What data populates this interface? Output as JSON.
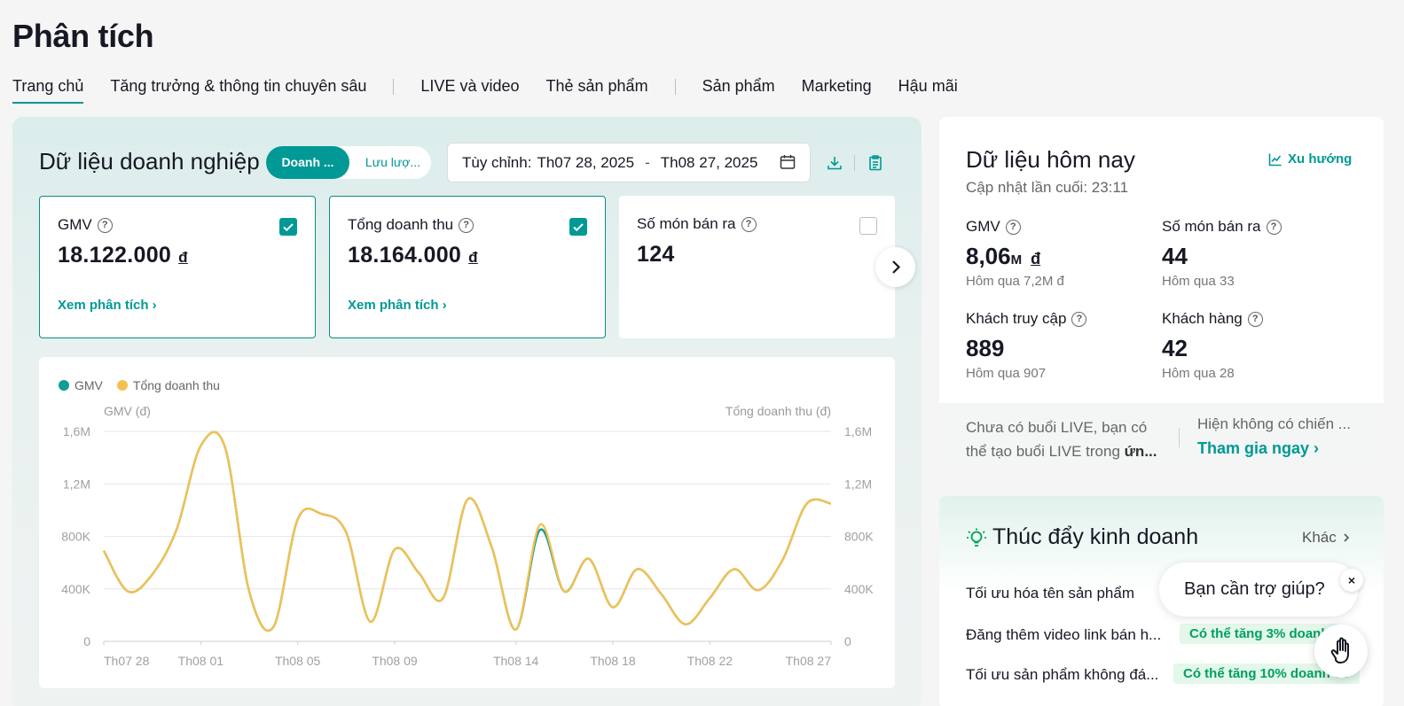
{
  "page_title": "Phân tích",
  "tabs": [
    {
      "label": "Trang chủ",
      "active": true
    },
    {
      "label": "Tăng trưởng & thông tin chuyên sâu"
    },
    {
      "label": "LIVE và video"
    },
    {
      "label": "Thẻ sản phẩm"
    },
    {
      "label": "Sản phẩm"
    },
    {
      "label": "Marketing"
    },
    {
      "label": "Hậu mãi"
    }
  ],
  "business": {
    "title": "Dữ liệu doanh nghiệp",
    "toggle_on": "Doanh ...",
    "toggle_off": "Lưu lượ...",
    "date_prefix": "Tùy chỉnh:",
    "date_start": "Th07 28, 2025",
    "date_sep": "-",
    "date_end": "Th08 27, 2025",
    "metrics": [
      {
        "label": "GMV",
        "value": "18.122.000",
        "currency": "đ",
        "link": "Xem phân tích ›",
        "checked": true
      },
      {
        "label": "Tổng doanh thu",
        "value": "18.164.000",
        "currency": "đ",
        "link": "Xem phân tích ›",
        "checked": true
      },
      {
        "label": "Số món bán ra",
        "value": "124",
        "checked": false
      }
    ]
  },
  "chart_data": {
    "type": "line",
    "legend": [
      "GMV",
      "Tổng doanh thu"
    ],
    "ylabel_left": "GMV (đ)",
    "ylabel_right": "Tổng doanh thu (đ)",
    "ylim": [
      0,
      1600000
    ],
    "yticks": [
      0,
      400000,
      800000,
      1200000,
      1600000
    ],
    "ytick_labels": [
      "0",
      "400K",
      "800K",
      "1,2M",
      "1,6M"
    ],
    "x": [
      "Th07 28",
      "Th07 29",
      "Th07 30",
      "Th07 31",
      "Th08 01",
      "Th08 02",
      "Th08 03",
      "Th08 04",
      "Th08 05",
      "Th08 06",
      "Th08 07",
      "Th08 08",
      "Th08 09",
      "Th08 10",
      "Th08 11",
      "Th08 12",
      "Th08 13",
      "Th08 14",
      "Th08 15",
      "Th08 16",
      "Th08 17",
      "Th08 18",
      "Th08 19",
      "Th08 20",
      "Th08 21",
      "Th08 22",
      "Th08 23",
      "Th08 24",
      "Th08 25",
      "Th08 26",
      "Th08 27"
    ],
    "x_tick_labels": [
      "Th07 28",
      "Th08 01",
      "Th08 05",
      "Th08 09",
      "Th08 14",
      "Th08 18",
      "Th08 22",
      "Th08 27"
    ],
    "series": [
      {
        "name": "GMV",
        "color": "#0f9d95",
        "values": [
          690000,
          380000,
          510000,
          850000,
          1490000,
          1480000,
          380000,
          110000,
          930000,
          970000,
          830000,
          150000,
          700000,
          520000,
          330000,
          1080000,
          720000,
          90000,
          850000,
          380000,
          630000,
          260000,
          550000,
          360000,
          130000,
          330000,
          550000,
          390000,
          620000,
          1050000,
          1050000
        ]
      },
      {
        "name": "Tổng doanh thu",
        "color": "#f5c04f",
        "values": [
          690000,
          380000,
          510000,
          850000,
          1490000,
          1480000,
          380000,
          110000,
          930000,
          970000,
          830000,
          150000,
          700000,
          520000,
          330000,
          1080000,
          720000,
          90000,
          890000,
          380000,
          630000,
          260000,
          550000,
          360000,
          130000,
          330000,
          550000,
          390000,
          620000,
          1050000,
          1050000
        ]
      }
    ]
  },
  "today": {
    "title": "Dữ liệu hôm nay",
    "trend_label": "Xu hướng",
    "updated": "Cập nhật lần cuối: 23:11",
    "stats": [
      {
        "label": "GMV",
        "value": "8,06",
        "unit": "M",
        "currency": "đ",
        "sub": "Hôm qua 7,2M đ"
      },
      {
        "label": "Số món bán ra",
        "value": "44",
        "sub": "Hôm qua 33"
      },
      {
        "label": "Khách truy cập",
        "value": "889",
        "sub": "Hôm qua 907"
      },
      {
        "label": "Khách hàng",
        "value": "42",
        "sub": "Hôm qua 28"
      }
    ],
    "live_text_1": "Chưa có buổi LIVE, bạn có",
    "live_text_2": "thể tạo buổi LIVE trong ",
    "live_text_bold": "ứn...",
    "campaign_text": "Hiện không có chiến ...",
    "campaign_link": "Tham gia ngay ›"
  },
  "boost": {
    "title": "Thúc đẩy kinh doanh",
    "more": "Khác",
    "items": [
      {
        "label": "Tối ưu hóa tên sản phẩm"
      },
      {
        "label": "Đăng thêm video link bán h...",
        "badge": "Có thể tăng 3% doanh"
      },
      {
        "label": "Tối ưu sản phẩm không đá...",
        "badge": "Có thể tăng 10% doanh số"
      }
    ]
  },
  "help": {
    "text": "Bạn cần trợ giúp?",
    "close": "×"
  },
  "colors": {
    "accent": "#009995",
    "gmv": "#0f9d95",
    "revenue": "#f5c04f"
  }
}
